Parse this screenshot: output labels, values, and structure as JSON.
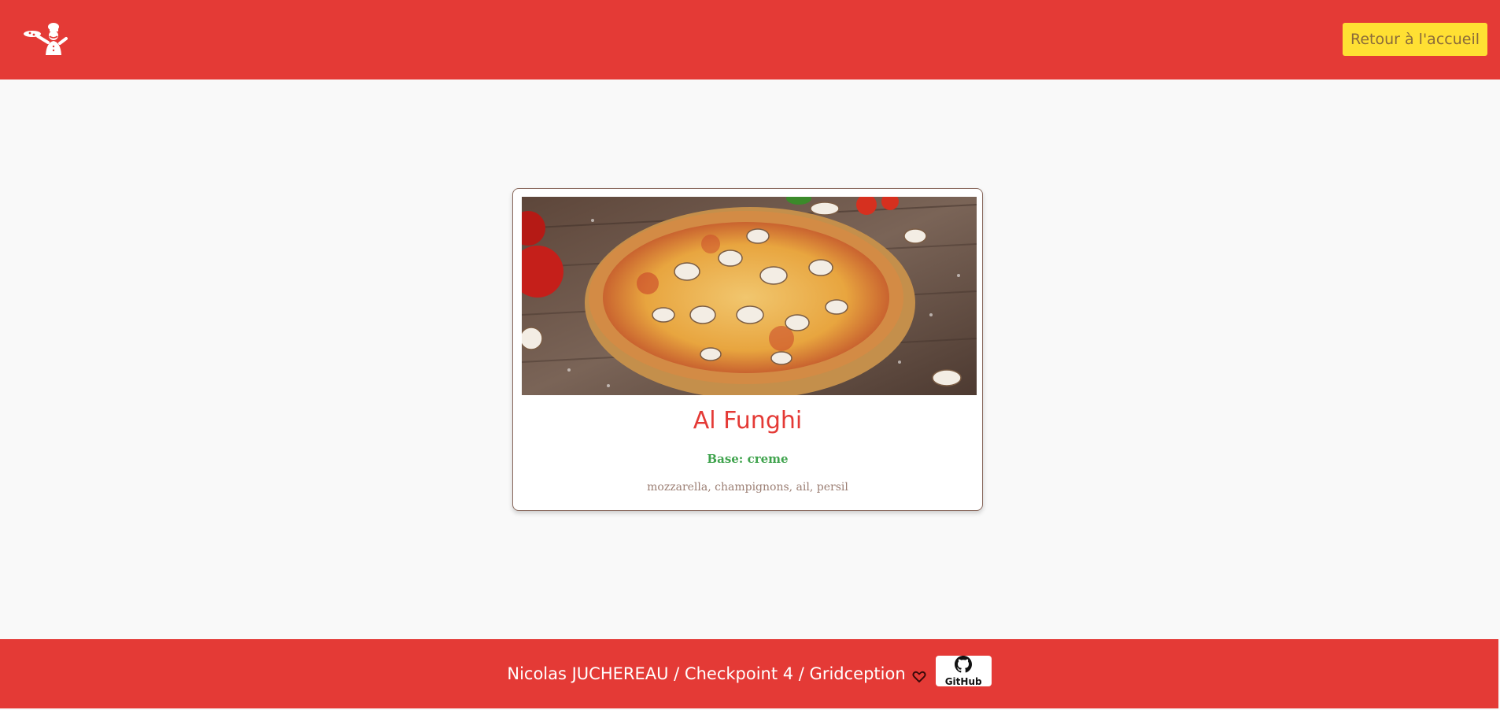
{
  "header": {
    "logo_icon": "chef-with-pizza-icon",
    "home_button_label": "Retour à l'accueil"
  },
  "pizza": {
    "name": "Al Funghi",
    "base": "Base: creme",
    "ingredients": "mozzarella, champignons, ail, persil",
    "photo_icon": "mushroom-pizza-photo"
  },
  "footer": {
    "credit": "Nicolas JUCHEREAU / Checkpoint 4 / Gridception",
    "heart_icon": "heart-icon",
    "github_label": "GitHub",
    "github_icon": "github-icon"
  },
  "colors": {
    "brand_red": "#e43a36",
    "button_yellow": "#ffe033",
    "base_green": "#3fa34d",
    "ingredients_brown": "#9b7e73",
    "background": "#f9f9f9"
  }
}
